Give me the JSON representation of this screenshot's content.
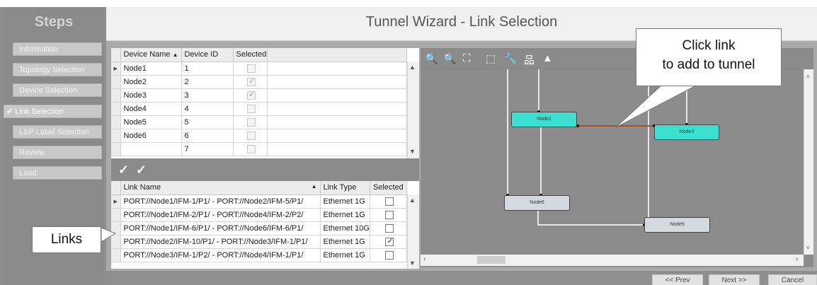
{
  "sidebar": {
    "title": "Steps",
    "items": [
      {
        "label": "Information",
        "check": ""
      },
      {
        "label": "Topology Selection",
        "check": ""
      },
      {
        "label": "Device Selection",
        "check": ""
      },
      {
        "label": "Link Selection",
        "check": "✔"
      },
      {
        "label": "LSP Label Selection",
        "check": ""
      },
      {
        "label": "Review",
        "check": ""
      },
      {
        "label": "Load",
        "check": ""
      }
    ]
  },
  "header": {
    "title": "Tunnel Wizard - Link Selection"
  },
  "device_table": {
    "columns": [
      "Device Name",
      "Device ID",
      "Selected"
    ],
    "sort_indicator": "▲",
    "rows": [
      {
        "name": "Node1",
        "id": "1",
        "selected": false
      },
      {
        "name": "Node2",
        "id": "2",
        "selected": true
      },
      {
        "name": "Node3",
        "id": "3",
        "selected": true
      },
      {
        "name": "Node4",
        "id": "4",
        "selected": false
      },
      {
        "name": "Node5",
        "id": "5",
        "selected": false
      },
      {
        "name": "Node6",
        "id": "6",
        "selected": false
      },
      {
        "name": "",
        "id": "7",
        "selected": false
      }
    ]
  },
  "link_toolbar": {
    "select_all_icon": "✓",
    "deselect_all_icon": "✓"
  },
  "link_table": {
    "columns": [
      "Link Name",
      "Link Type",
      "Selected"
    ],
    "sort_indicator": "▲",
    "rows": [
      {
        "name": "PORT://Node1/IFM-1/P1/ - PORT://Node2/IFM-5/P1/",
        "type": "Ethernet 1G",
        "selected": false
      },
      {
        "name": "PORT://Node1/IFM-2/P1/ - PORT://Node4/IFM-2/P2/",
        "type": "Ethernet 1G",
        "selected": false
      },
      {
        "name": "PORT://Node1/IFM-6/P1/ - PORT://Node6/IFM-6/P1/",
        "type": "Ethernet 10G",
        "selected": false
      },
      {
        "name": "PORT://Node2/IFM-10/P1/ - PORT://Node3/IFM-1/P1/",
        "type": "Ethernet 1G",
        "selected": true
      },
      {
        "name": "PORT://Node3/IFM-1/P2/ - PORT://Node4/IFM-1/P1/",
        "type": "Ethernet 1G",
        "selected": false
      }
    ]
  },
  "graph": {
    "tools": [
      "zoom-in-icon",
      "zoom-out-icon",
      "fit-icon",
      "select-icon",
      "wrench-icon",
      "hierarchy-icon",
      "image-icon"
    ],
    "nodes": {
      "node2": "Node2",
      "node3": "Node3",
      "node6": "Node6",
      "node5": "Node5"
    },
    "selected_link_color": "#a0522d"
  },
  "callouts": {
    "click_link_line1": "Click link",
    "click_link_line2": "to add to tunnel",
    "links": "Links"
  },
  "footer": {
    "prev": "<< Prev",
    "next": "Next >>",
    "cancel": "Cancel"
  }
}
